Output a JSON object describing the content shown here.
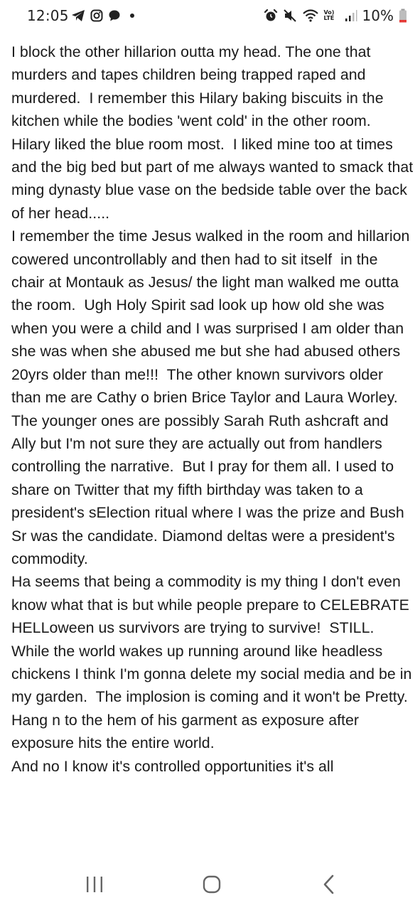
{
  "status_bar": {
    "time": "12:05",
    "battery": "10%",
    "network": "Vo) LTE"
  },
  "post": {
    "paragraphs": [
      "I block the other hillarion outta my head. The one that murders and tapes children being trapped raped and murdered.  I remember this Hilary baking biscuits in the kitchen while the bodies 'went cold' in the other room. Hilary liked the blue room most.  I liked mine too at times and the big bed but part of me always wanted to smack that ming dynasty blue vase on the bedside table over the back of her head.....",
      "I remember the time Jesus walked in the room and hillarion cowered uncontrollably and then had to sit itself  in the chair at Montauk as Jesus/ the light man walked me outta the room.  Ugh Holy Spirit sad look up how old she was when you were a child and I was surprised I am older than she was when she abused me but she had abused others 20yrs older than me!!!  The other known survivors older than me are Cathy o brien Brice Taylor and Laura Worley. The younger ones are possibly Sarah Ruth ashcraft and Ally but I'm not sure they are actually out from handlers controlling the narrative.  But I pray for them all. I used to share on Twitter that my fifth birthday was taken to a president's sElection ritual where I was the prize and Bush Sr was the candidate. Diamond deltas were a president's commodity.",
      "Ha seems that being a commodity is my thing I don't even know what that is but while people prepare to CELEBRATE HELLoween us survivors are trying to survive!  STILL. While the world wakes up running around like headless chickens I think I'm gonna delete my social media and be in my garden.  The implosion is coming and it won't be Pretty. Hang n to the hem of his garment as exposure after exposure hits the entire world.",
      "And no I know it's controlled opportunities it's all"
    ]
  }
}
